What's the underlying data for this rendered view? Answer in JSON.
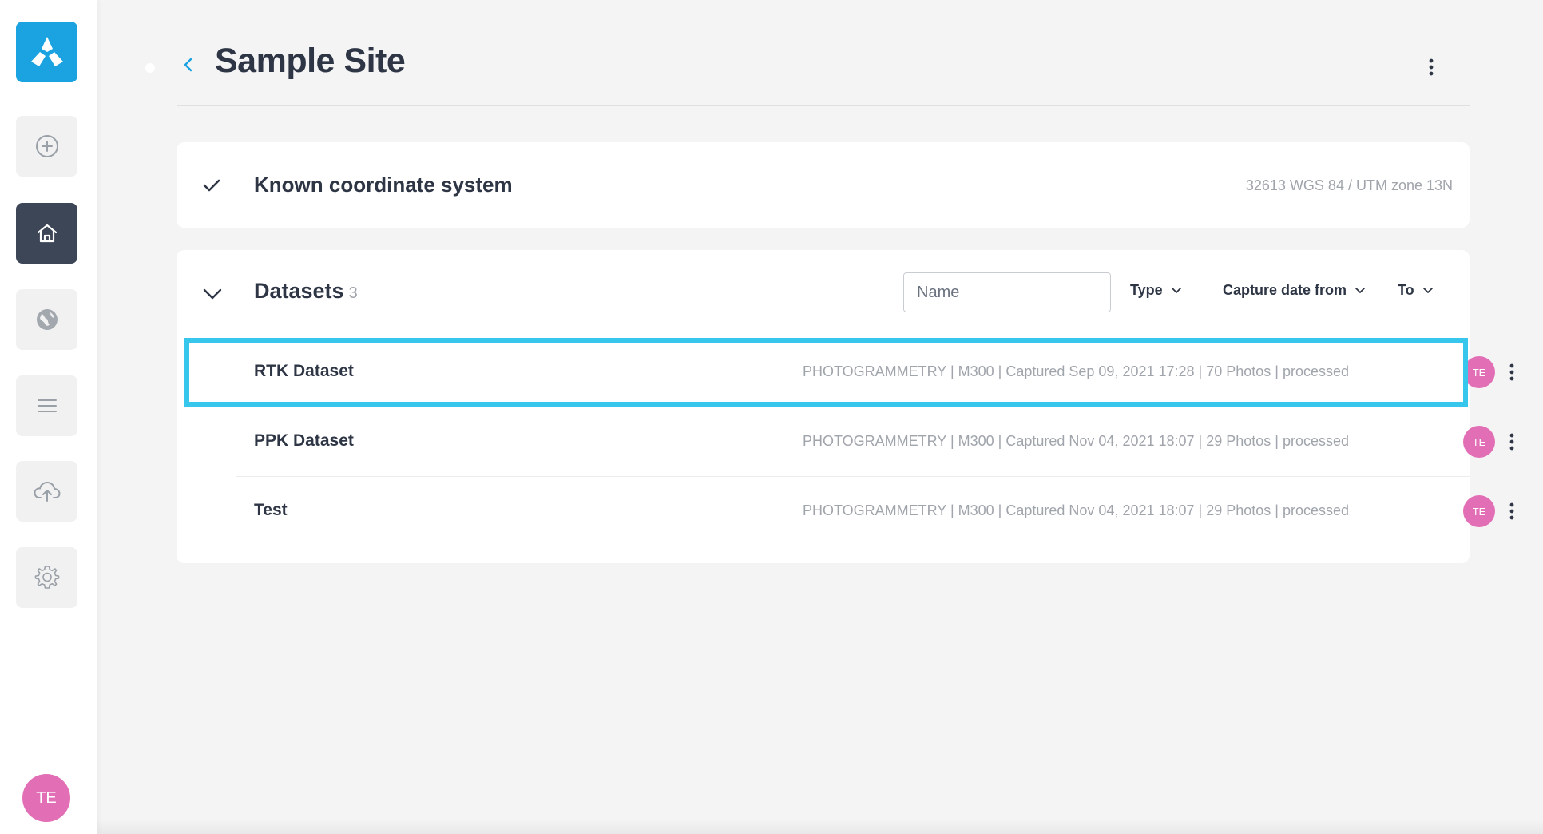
{
  "sidebar": {
    "logo_icon": "brand-logo-icon",
    "items": [
      {
        "name": "add",
        "icon": "plus-circle-icon"
      },
      {
        "name": "home",
        "icon": "home-icon",
        "active": true
      },
      {
        "name": "globe",
        "icon": "globe-icon"
      },
      {
        "name": "list",
        "icon": "menu-lines-icon"
      },
      {
        "name": "upload",
        "icon": "cloud-upload-icon"
      },
      {
        "name": "settings",
        "icon": "gear-icon"
      }
    ],
    "user_initials": "TE"
  },
  "header": {
    "title": "Sample Site",
    "back_icon": "chevron-left-icon",
    "menu_icon": "kebab-menu-icon"
  },
  "coordinate_system": {
    "title": "Known coordinate system",
    "value": "32613 WGS 84 / UTM zone 13N",
    "status_icon": "check-icon"
  },
  "datasets": {
    "title": "Datasets",
    "count": "3",
    "name_placeholder": "Name",
    "filters": {
      "type_label": "Type",
      "from_label": "Capture date from",
      "to_label": "To"
    },
    "rows": [
      {
        "name": "RTK Dataset",
        "meta": "PHOTOGRAMMETRY | M300 | Captured Sep 09, 2021 17:28 | 70 Photos | processed",
        "avatar": "TE"
      },
      {
        "name": "PPK Dataset",
        "meta": "PHOTOGRAMMETRY | M300 | Captured Nov 04, 2021 18:07 | 29 Photos | processed",
        "avatar": "TE"
      },
      {
        "name": "Test",
        "meta": "PHOTOGRAMMETRY | M300 | Captured Nov 04, 2021 18:07 | 29 Photos | processed",
        "avatar": "TE"
      }
    ]
  },
  "colors": {
    "brand": "#1aa3e0",
    "highlight": "#37c6ec",
    "avatar": "#e26fb5",
    "active_nav": "#3c4656"
  }
}
